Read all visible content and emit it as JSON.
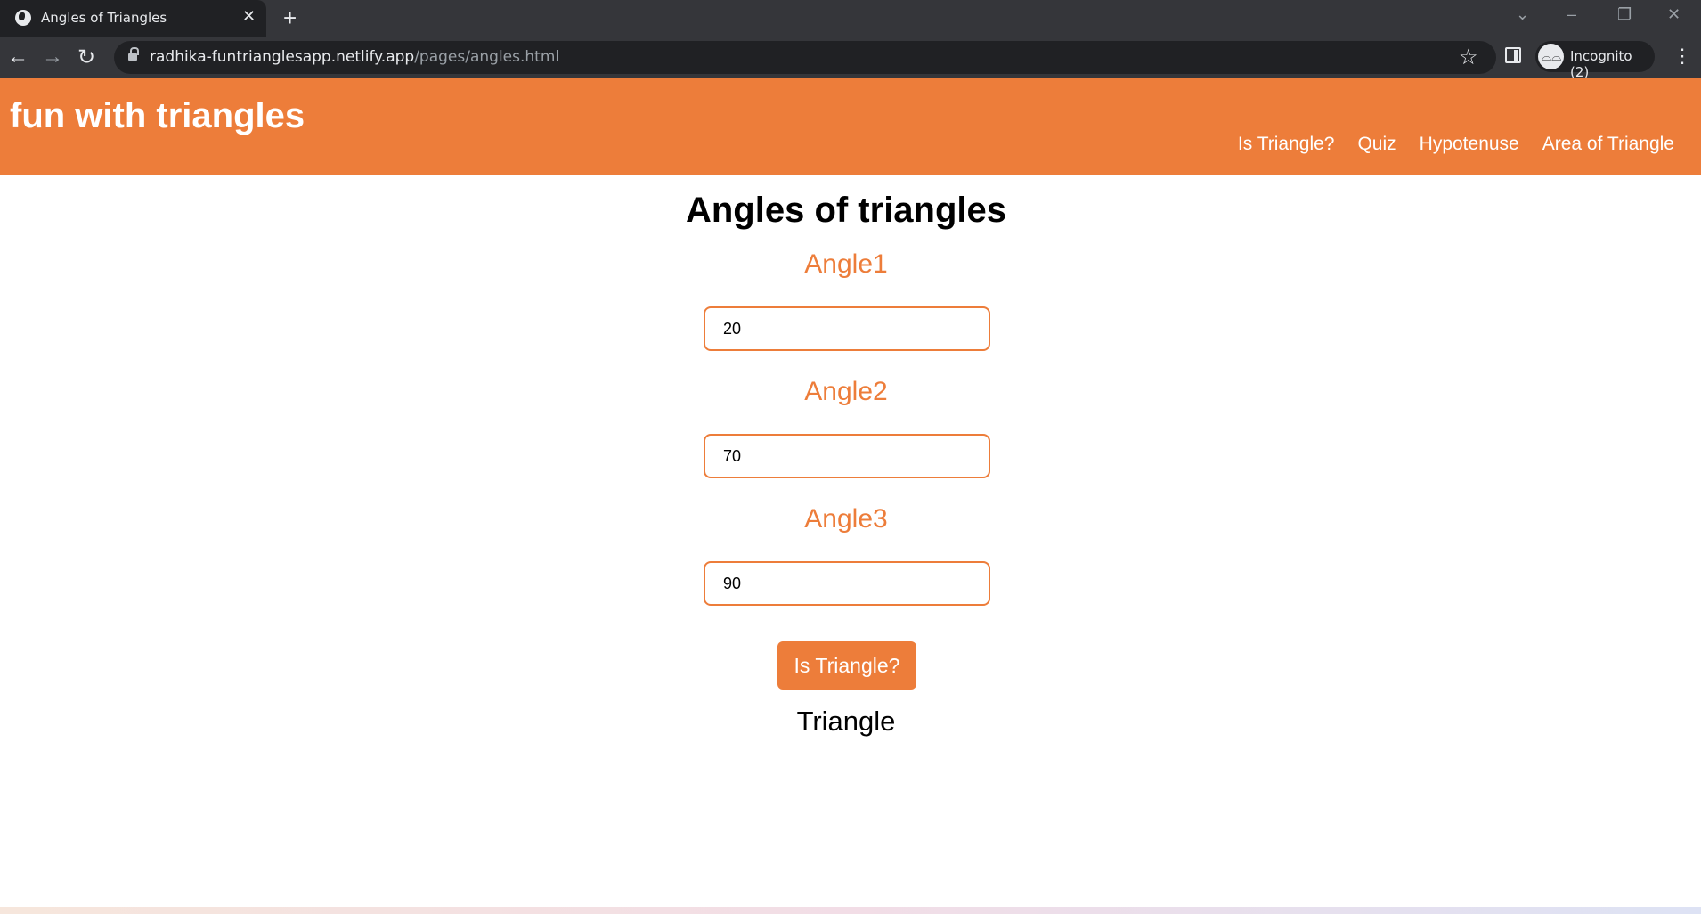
{
  "browser": {
    "tab_title": "Angles of Triangles",
    "url_domain": "radhika-funtrianglesapp.netlify.app",
    "url_path": "/pages/angles.html",
    "profile_label": "Incognito (2)"
  },
  "header": {
    "title": "fun with triangles",
    "nav": [
      "Is Triangle?",
      "Quiz",
      "Hypotenuse",
      "Area of Triangle"
    ]
  },
  "main": {
    "heading": "Angles of triangles",
    "angles": [
      {
        "label": "Angle1",
        "value": "20"
      },
      {
        "label": "Angle2",
        "value": "70"
      },
      {
        "label": "Angle3",
        "value": "90"
      }
    ],
    "button_label": "Is Triangle?",
    "result": "Triangle"
  },
  "colors": {
    "accent": "#ed7d3a",
    "chrome_bg": "#35363a",
    "omnibox_bg": "#202124"
  }
}
